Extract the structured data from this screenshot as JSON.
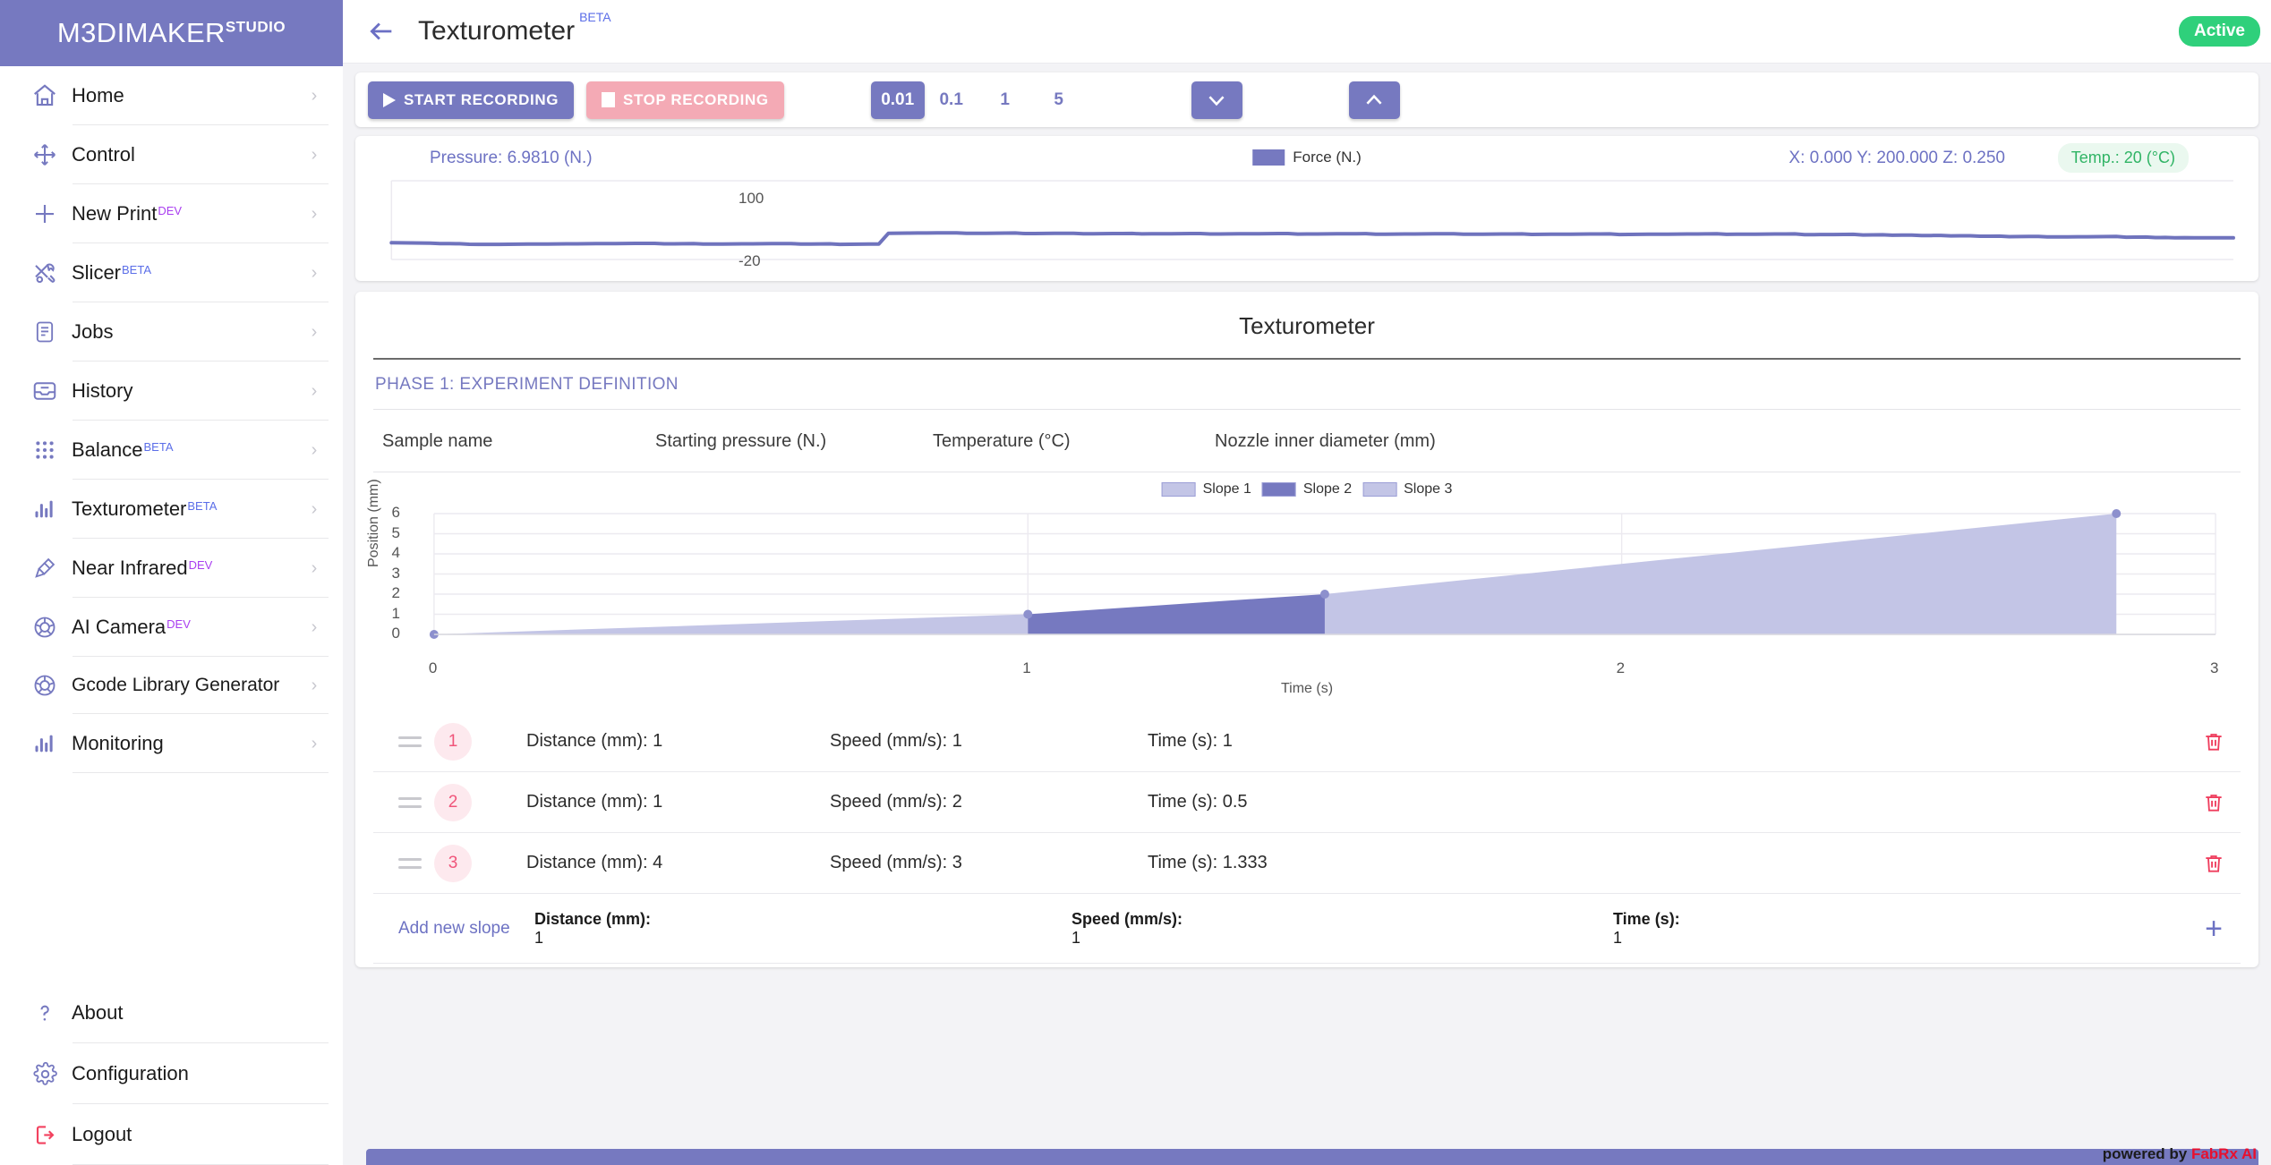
{
  "brand": {
    "name": "M3DIMAKER",
    "sup": "STUDIO"
  },
  "sidebar": {
    "items": [
      {
        "label": "Home",
        "icon": "home-icon",
        "tag": "",
        "tag_type": ""
      },
      {
        "label": "Control",
        "icon": "move-icon",
        "tag": "",
        "tag_type": ""
      },
      {
        "label": "New Print",
        "icon": "plus-icon",
        "tag": "DEV",
        "tag_type": "dev"
      },
      {
        "label": "Slicer",
        "icon": "tools-icon",
        "tag": "BETA",
        "tag_type": "beta"
      },
      {
        "label": "Jobs",
        "icon": "document-icon",
        "tag": "",
        "tag_type": ""
      },
      {
        "label": "History",
        "icon": "inbox-icon",
        "tag": "",
        "tag_type": ""
      },
      {
        "label": "Balance",
        "icon": "grid-dots-icon",
        "tag": "BETA",
        "tag_type": "beta"
      },
      {
        "label": "Texturometer",
        "icon": "bar-chart-icon",
        "tag": "BETA",
        "tag_type": "beta"
      },
      {
        "label": "Near Infrared",
        "icon": "flashlight-icon",
        "tag": "DEV",
        "tag_type": "dev"
      },
      {
        "label": "AI Camera",
        "icon": "aperture-icon",
        "tag": "DEV",
        "tag_type": "dev"
      },
      {
        "label": "Gcode Library Generator",
        "icon": "aperture-icon",
        "tag": "",
        "tag_type": ""
      },
      {
        "label": "Monitoring",
        "icon": "bar-chart-icon",
        "tag": "",
        "tag_type": ""
      }
    ],
    "bottom_items": [
      {
        "label": "About",
        "icon": "question-icon"
      },
      {
        "label": "Configuration",
        "icon": "gear-icon"
      },
      {
        "label": "Logout",
        "icon": "logout-icon"
      }
    ]
  },
  "header": {
    "back_icon": "back-arrow-icon",
    "title": "Texturometer",
    "title_tag": "BETA",
    "status": "Active"
  },
  "toolbar": {
    "start_label": "START RECORDING",
    "stop_label": "STOP RECORDING",
    "steps": [
      "0.01",
      "0.1",
      "1",
      "5"
    ],
    "active_step": "0.01",
    "down_icon": "chevron-down-icon",
    "up_icon": "chevron-up-icon"
  },
  "force_panel": {
    "pressure_label": "Pressure: 6.9810 (N.)",
    "legend_label": "Force (N.)",
    "coordinates": "X: 0.000 Y: 200.000 Z: 0.250",
    "temperature": "Temp.: 20 (°C)"
  },
  "texturometer": {
    "title": "Texturometer",
    "phase_label": "PHASE 1: EXPERIMENT DEFINITION",
    "fields": [
      "Sample name",
      "Starting pressure (N.)",
      "Temperature (°C)",
      "Nozzle inner diameter (mm)"
    ],
    "slopes": [
      {
        "index": "1",
        "distance": "Distance (mm): 1",
        "speed": "Speed (mm/s): 1",
        "time": "Time (s): 1",
        "delete_icon": "trash-icon"
      },
      {
        "index": "2",
        "distance": "Distance (mm): 1",
        "speed": "Speed (mm/s): 2",
        "time": "Time (s): 0.5",
        "delete_icon": "trash-icon"
      },
      {
        "index": "3",
        "distance": "Distance (mm): 4",
        "speed": "Speed (mm/s): 3",
        "time": "Time (s): 1.333",
        "delete_icon": "trash-icon"
      }
    ],
    "add_row": {
      "link": "Add new slope",
      "distance_label": "Distance (mm):",
      "distance_value": "1",
      "speed_label": "Speed (mm/s):",
      "speed_value": "1",
      "time_label": "Time (s):",
      "time_value": "1",
      "add_icon": "plus-icon"
    }
  },
  "footer": {
    "powered_prefix": "powered by ",
    "powered_brand": "FabRx AI"
  },
  "colors": {
    "accent": "#7679c0",
    "stop": "#f4aab5",
    "active_green": "#2fd07b",
    "danger": "#ef3d5d",
    "slope_light": "#c3c5e6",
    "slope_dark": "#7679c0"
  },
  "chart_data": [
    {
      "type": "line",
      "id": "force-chart",
      "title": "",
      "xlabel": "",
      "ylabel": "Force (N.)",
      "ylim": [
        -20,
        100
      ],
      "yticks": [
        -20,
        100
      ],
      "grid": false,
      "legend": [
        "Force (N.)"
      ],
      "legend_position": "top-center",
      "series": [
        {
          "name": "Force (N.)",
          "values": [
            5.5,
            5.3,
            5.2,
            5.1,
            5.0,
            4.2,
            4.1,
            4.0,
            3.2,
            3.1,
            3.0,
            3.1,
            3.2,
            3.3,
            3.4,
            3.5,
            3.6,
            3.7,
            3.8,
            3.9,
            4.0,
            4.1,
            4.2,
            4.3,
            4.4,
            4.5,
            4.6,
            4.5,
            3.8,
            3.9,
            4.0,
            4.1,
            3.4,
            3.5,
            3.6,
            3.7,
            3.8,
            3.9,
            4.0,
            4.1,
            4.2,
            4.3,
            3.5,
            3.6,
            3.7,
            3.8,
            3.1,
            3.2,
            3.3,
            3.4,
            3.4,
            20.0,
            20.1,
            20.2,
            20.3,
            20.4,
            20.5,
            20.6,
            20.7,
            19.8,
            19.9,
            20.0,
            20.1,
            20.2,
            20.3,
            19.5,
            19.6,
            19.7,
            19.8,
            19.9,
            20.0,
            19.2,
            19.3,
            19.4,
            19.5,
            19.6,
            19.7,
            19.0,
            19.1,
            19.2,
            19.3,
            19.4,
            19.5,
            19.6,
            18.8,
            18.9,
            19.0,
            19.1,
            19.2,
            19.3,
            19.4,
            19.5,
            19.6,
            18.7,
            18.8,
            18.9,
            19.0,
            19.1,
            19.2,
            19.3,
            19.4,
            18.5,
            18.6,
            18.7,
            18.8,
            18.9,
            19.0,
            19.1,
            19.2,
            19.3,
            18.4,
            18.5,
            18.6,
            18.7,
            18.8,
            18.9,
            19.0,
            18.2,
            18.3,
            18.4,
            18.5,
            18.6,
            18.7,
            18.8,
            18.9,
            19.0,
            18.1,
            18.2,
            18.3,
            18.4,
            18.5,
            18.6,
            18.7,
            18.8,
            18.9,
            19.0,
            19.1,
            18.3,
            18.4,
            18.5,
            18.6,
            18.7,
            18.8,
            18.9,
            19.0,
            17.8,
            17.9,
            18.0,
            18.1,
            18.2,
            18.3,
            17.4,
            17.5,
            17.6,
            17.0,
            17.1,
            17.2,
            16.5,
            16.6,
            16.7,
            16.0,
            16.1,
            16.2,
            15.4,
            15.5,
            15.6,
            14.8,
            14.9,
            15.0,
            15.1,
            14.3,
            14.4,
            14.5,
            14.6,
            14.7,
            14.8,
            14.9,
            15.0,
            14.0,
            14.1,
            14.2,
            13.4,
            13.5,
            13.2,
            13.3,
            13.0,
            13.1,
            13.0,
            13.1,
            13.0
          ]
        }
      ]
    },
    {
      "type": "area",
      "id": "slope-chart",
      "title": "",
      "xlabel": "Time (s)",
      "ylabel": "Position (mm)",
      "xlim": [
        0,
        3
      ],
      "ylim": [
        0,
        6
      ],
      "xticks": [
        0,
        1,
        2,
        3
      ],
      "yticks": [
        0,
        1,
        2,
        3,
        4,
        5,
        6
      ],
      "grid": true,
      "legend": [
        "Slope 1",
        "Slope 2",
        "Slope 3"
      ],
      "legend_position": "top-center",
      "points": [
        {
          "t": 0,
          "position": 0
        },
        {
          "t": 1,
          "position": 1
        },
        {
          "t": 1.5,
          "position": 2
        },
        {
          "t": 2.833,
          "position": 6
        }
      ],
      "segments": [
        {
          "name": "Slope 1",
          "from": [
            0,
            0
          ],
          "to": [
            1,
            1
          ],
          "color": "#c3c5e6"
        },
        {
          "name": "Slope 2",
          "from": [
            1,
            1
          ],
          "to": [
            1.5,
            2
          ],
          "color": "#7679c0"
        },
        {
          "name": "Slope 3",
          "from": [
            1.5,
            2
          ],
          "to": [
            2.833,
            6
          ],
          "color": "#c3c5e6"
        }
      ]
    }
  ]
}
